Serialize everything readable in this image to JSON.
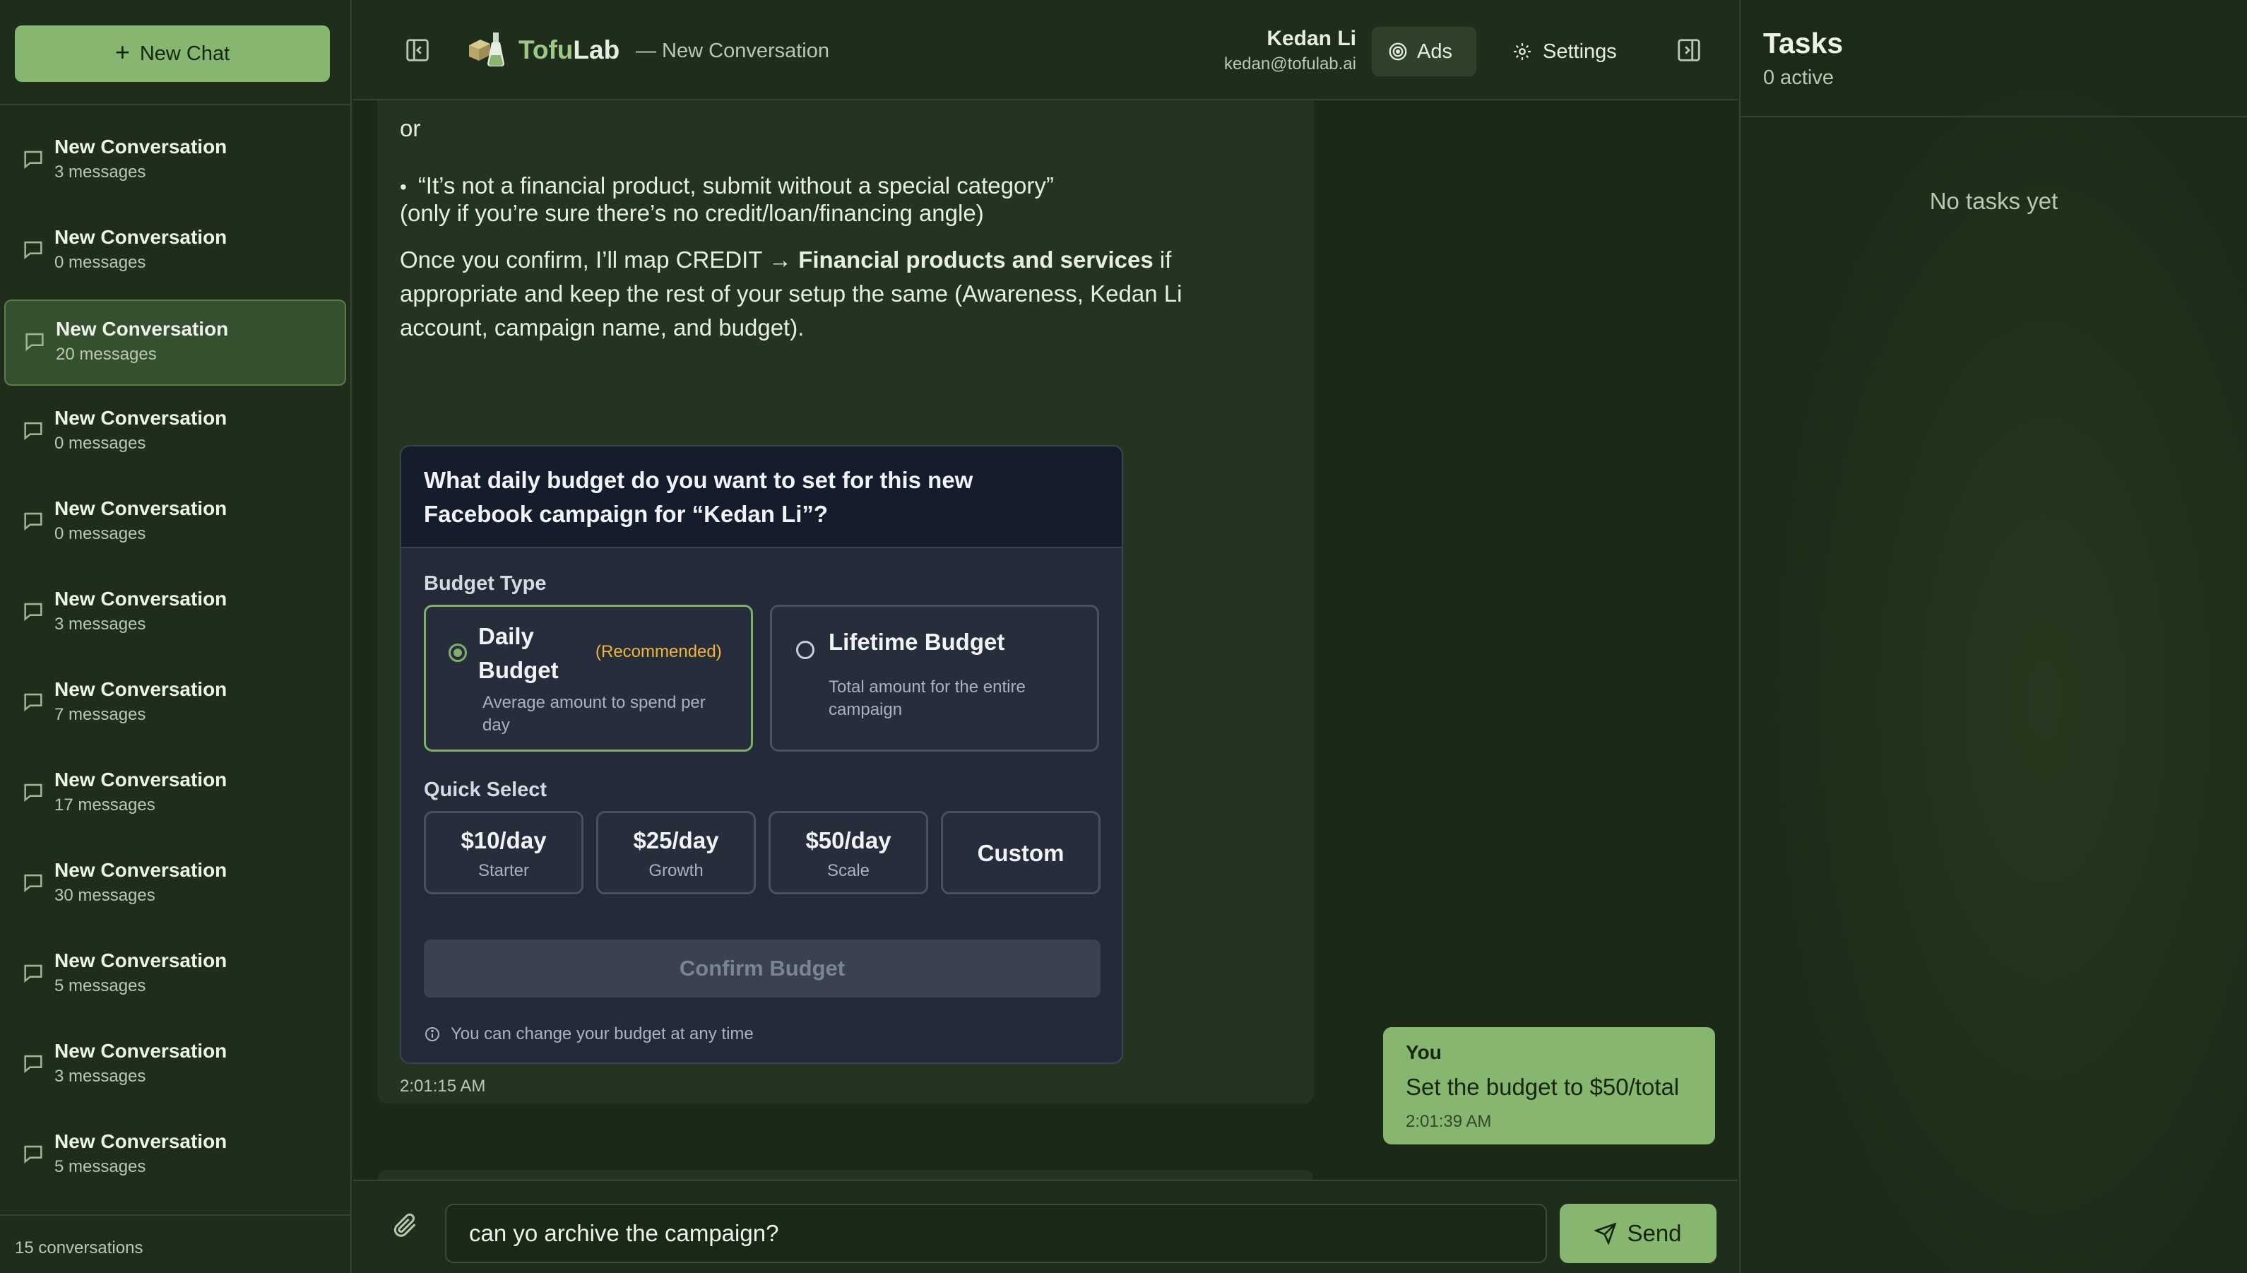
{
  "sidebar": {
    "new_chat_label": "New Chat",
    "conversations": [
      {
        "title": "New Conversation",
        "count": "3 messages"
      },
      {
        "title": "New Conversation",
        "count": "0 messages"
      },
      {
        "title": "New Conversation",
        "count": "20 messages"
      },
      {
        "title": "New Conversation",
        "count": "0 messages"
      },
      {
        "title": "New Conversation",
        "count": "0 messages"
      },
      {
        "title": "New Conversation",
        "count": "3 messages"
      },
      {
        "title": "New Conversation",
        "count": "7 messages"
      },
      {
        "title": "New Conversation",
        "count": "17 messages"
      },
      {
        "title": "New Conversation",
        "count": "30 messages"
      },
      {
        "title": "New Conversation",
        "count": "5 messages"
      },
      {
        "title": "New Conversation",
        "count": "3 messages"
      },
      {
        "title": "New Conversation",
        "count": "5 messages"
      }
    ],
    "footer": "15 conversations"
  },
  "header": {
    "brand_a": "Tofu",
    "brand_b": "Lab",
    "conversation_label": "— New Conversation",
    "user_name": "Kedan Li",
    "user_email": "kedan@tofulab.ai",
    "ads_label": "Ads",
    "settings_label": "Settings"
  },
  "assistant": {
    "line_or": "or",
    "bullet": "“It’s not a financial product, submit without a special category”",
    "paren_note": "(only if you’re sure there’s no credit/loan/financing angle)",
    "confirm_pre": "Once you confirm, I’ll map CREDIT → ",
    "confirm_bold": "Financial products and services",
    "confirm_post": " if",
    "confirm_line2": "appropriate and keep the rest of your setup the same (Awareness, Kedan Li",
    "confirm_line3": "account, campaign name, and budget).",
    "time": "2:01:15 AM",
    "budget_card": {
      "question": "What daily budget do you want to set for this new Facebook campaign for “Kedan Li”?",
      "budget_type_label": "Budget Type",
      "daily_title": "Daily Budget",
      "recommended": "(Recommended)",
      "daily_desc": "Average amount to spend per day",
      "lifetime_title": "Lifetime Budget",
      "lifetime_desc": "Total amount for the entire campaign",
      "quick_select_label": "Quick Select",
      "options": [
        {
          "amount": "$10/day",
          "tier": "Starter"
        },
        {
          "amount": "$25/day",
          "tier": "Growth"
        },
        {
          "amount": "$50/day",
          "tier": "Scale"
        }
      ],
      "custom_label": "Custom",
      "confirm_label": "Confirm Budget",
      "note": "You can change your budget at any time"
    }
  },
  "user_message": {
    "who": "You",
    "text": "Set the budget to $50/total",
    "time": "2:01:39 AM"
  },
  "composer": {
    "input_value": "can yo archive the campaign?",
    "send_label": "Send"
  },
  "tasks": {
    "title": "Tasks",
    "count": "0 active",
    "empty": "No tasks yet"
  },
  "colors": {
    "accent": "#86b66f",
    "recommended": "#f1b53a",
    "card_bg": "#242a38"
  }
}
